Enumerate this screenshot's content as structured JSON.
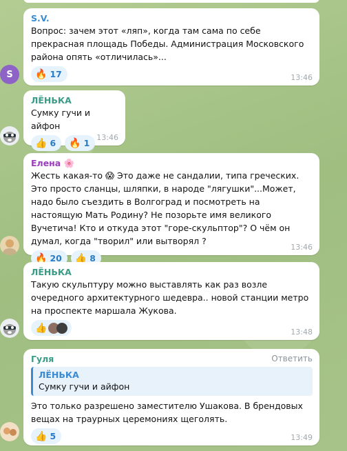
{
  "messages": [
    {
      "sender": "S.V.",
      "sender_color": "#3a8bd1",
      "text": "Вопрос: зачем этот «ляп», когда там сама по себе прекрасная площадь Победы.  Администрация Московского района опять «отличилась»...",
      "reactions": [
        {
          "emoji": "🔥",
          "count": "17"
        }
      ],
      "time": "13:46",
      "avatar_letter": "S",
      "avatar_color": "#8e63c7"
    },
    {
      "sender": "ЛЁНЬКА",
      "sender_color": "#3a9b87",
      "text": "Сумку гучи и айфон",
      "reactions": [
        {
          "emoji": "👍",
          "count": "6"
        },
        {
          "emoji": "🔥",
          "count": "1"
        }
      ],
      "time": "13:46"
    },
    {
      "sender": "Елена",
      "sender_emoji": "🌸",
      "sender_color": "#9b3dbd",
      "text_part1": "Жесть какая-то ",
      "inline_emoji": "😱",
      "text_part2": " Это даже не сандалии, типа греческих. Это просто сланцы, шляпки, в народе \"лягушки\"...Может,  надо было съездить в Волгоград и посмотреть на настоящую Мать Родину? Не позорьте имя великого Вучетича! Кто и откуда этот \"горе-скульптор\"? О чём он думал,  когда \"творил\" или вытворял ?",
      "reactions": [
        {
          "emoji": "🔥",
          "count": "20"
        },
        {
          "emoji": "👍",
          "count": "8"
        }
      ],
      "time": "13:46"
    },
    {
      "sender": "ЛЁНЬКА",
      "sender_color": "#3a9b87",
      "text": "Такую скульптуру можно выставлять как раз возле очередного архитектурного шедевра.. новой станции метро на проспекте маршала Жукова.",
      "reactions": [
        {
          "emoji": "👍"
        }
      ],
      "time": "13:48"
    },
    {
      "sender": "Гуля",
      "sender_color": "#3a9b87",
      "reply_label": "Ответить",
      "quote_name": "ЛЁНЬКА",
      "quote_text": "Сумку гучи и айфон",
      "text": "Это только разрешено заместителю Ушакова. В брендовых вещах на траурных церемониях щеголять.",
      "reactions": [
        {
          "emoji": "👍",
          "count": "5"
        }
      ],
      "time": "13:49"
    }
  ]
}
